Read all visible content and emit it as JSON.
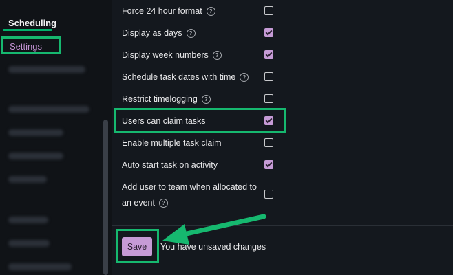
{
  "sidebar": {
    "section_title": "Scheduling",
    "settings_label": "Settings"
  },
  "settings": [
    {
      "label": "Force 24 hour format",
      "help": true,
      "checked": false
    },
    {
      "label": "Display as days",
      "help": true,
      "checked": true
    },
    {
      "label": "Display week numbers",
      "help": true,
      "checked": true
    },
    {
      "label": "Schedule task dates with time",
      "help": true,
      "checked": false
    },
    {
      "label": "Restrict timelogging",
      "help": true,
      "checked": false
    },
    {
      "label": "Users can claim tasks",
      "help": false,
      "checked": true
    },
    {
      "label": "Enable multiple task claim",
      "help": false,
      "checked": false
    },
    {
      "label": "Auto start task on activity",
      "help": false,
      "checked": true
    },
    {
      "label_line1": "Add user to team when allocated to",
      "label_line2": "an event",
      "help": true,
      "checked": false
    }
  ],
  "footer": {
    "save_label": "Save",
    "unsaved_text": "You have unsaved changes"
  },
  "colors": {
    "accent": "#c69bd6",
    "highlight": "#16b86f",
    "background": "#14181e"
  },
  "icons": {
    "help": "question-circle-icon",
    "annotation": "arrow-icon"
  }
}
